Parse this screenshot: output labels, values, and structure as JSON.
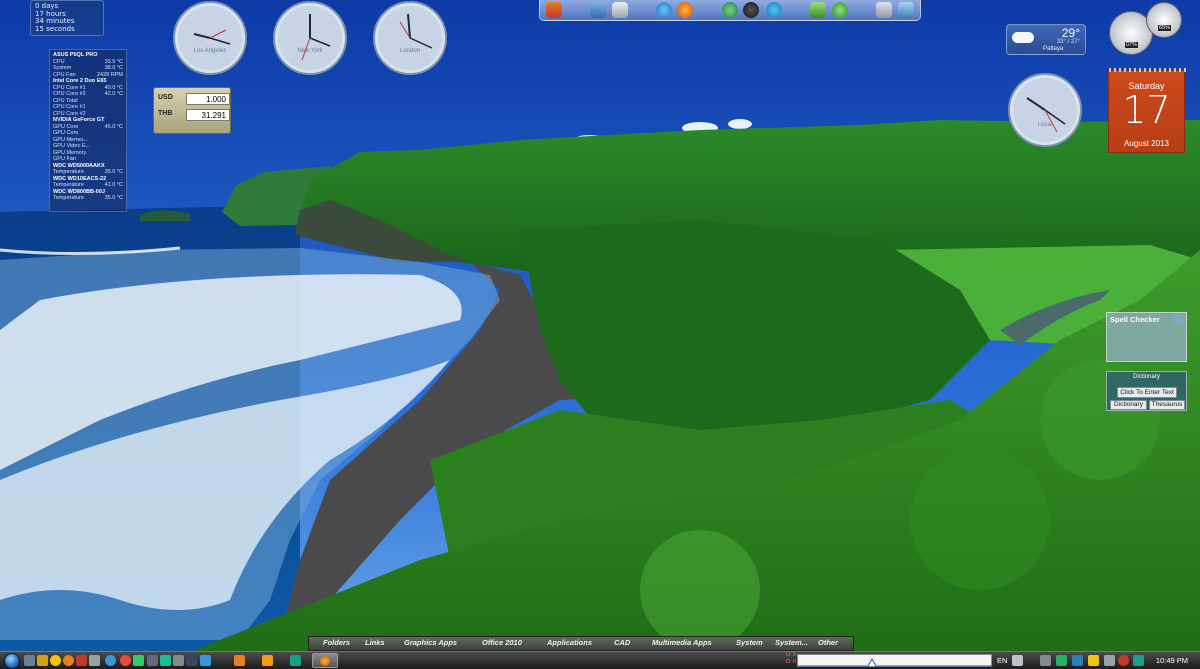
{
  "uptime": {
    "lines": [
      "0 days",
      "17 hours",
      "34 minutes",
      "15 seconds"
    ]
  },
  "clocks": [
    {
      "city": "Los Angeles"
    },
    {
      "city": "New York"
    },
    {
      "city": "London"
    },
    {
      "city": "Local"
    }
  ],
  "currency": {
    "from_code": "USD",
    "from_value": "1.000",
    "to_code": "THB",
    "to_value": "31.291"
  },
  "sysmon": {
    "rows": [
      {
        "label": "ASUS P5QL PRO",
        "value": "",
        "header": true
      },
      {
        "label": "CPU",
        "value": "33.5 °C",
        "header": false
      },
      {
        "label": "System",
        "value": "38.0 °C",
        "header": false
      },
      {
        "label": "CPU Fan",
        "value": "2428 RPM",
        "header": false
      },
      {
        "label": "Intel Core 2 Duo E65",
        "value": "",
        "header": true
      },
      {
        "label": "CPU Core #1",
        "value": "40.0 °C",
        "header": false
      },
      {
        "label": "CPU Core #2",
        "value": "42.0 °C",
        "header": false
      },
      {
        "label": "CPU Total",
        "value": "",
        "header": false
      },
      {
        "label": "CPU Core #1",
        "value": "",
        "header": false
      },
      {
        "label": "CPU Core #2",
        "value": "",
        "header": false
      },
      {
        "label": "NVIDIA GeForce GT",
        "value": "",
        "header": true
      },
      {
        "label": "GPU Core",
        "value": "45.0 °C",
        "header": false
      },
      {
        "label": "GPU Core",
        "value": "",
        "header": false
      },
      {
        "label": "GPU Memor...",
        "value": "",
        "header": false
      },
      {
        "label": "GPU Video E...",
        "value": "",
        "header": false
      },
      {
        "label": "GPU Memory",
        "value": "",
        "header": false
      },
      {
        "label": "GPU Fan",
        "value": "",
        "header": false
      },
      {
        "label": "WDC WD5000AAKX",
        "value": "",
        "header": true
      },
      {
        "label": "Temperature",
        "value": "35.0 °C",
        "header": false
      },
      {
        "label": "WDC WD10EACS-22",
        "value": "",
        "header": true
      },
      {
        "label": "Temperature",
        "value": "41.0 °C",
        "header": false
      },
      {
        "label": "WDC WD800BB-00J",
        "value": "",
        "header": true
      },
      {
        "label": "Temperature",
        "value": "35.0 °C",
        "header": false
      }
    ]
  },
  "weather": {
    "temp": "29°",
    "range": "33° / 27°",
    "city": "Pattaya"
  },
  "meters": {
    "cpu": "07%",
    "ram": "65%"
  },
  "calendar": {
    "weekday": "Saturday",
    "day": "17",
    "month_year": "August 2013"
  },
  "spell": {
    "title": "Spell Checker"
  },
  "dictionary": {
    "title": "Dictionary",
    "prompt": "Click To Enter Text",
    "dictionary_button": "Dictionary",
    "thesaurus_button": "Thesaurus"
  },
  "launchbar": {
    "items": [
      "Folders",
      "Links",
      "Graphics Apps",
      "Office 2010",
      "Applications",
      "CAD",
      "Multimedia Apps",
      "System",
      "System...",
      "Other"
    ]
  },
  "taskbar": {
    "language": "EN",
    "time": "10:49 PM",
    "net_up": "U: 0",
    "net_down": "D: 0"
  },
  "colors": {
    "calendar_bg": "#c4451a",
    "launchbar_bg": "#4a5447",
    "taskbar_bg": "#2a2a2a",
    "weather_bg": "#3558a8"
  }
}
